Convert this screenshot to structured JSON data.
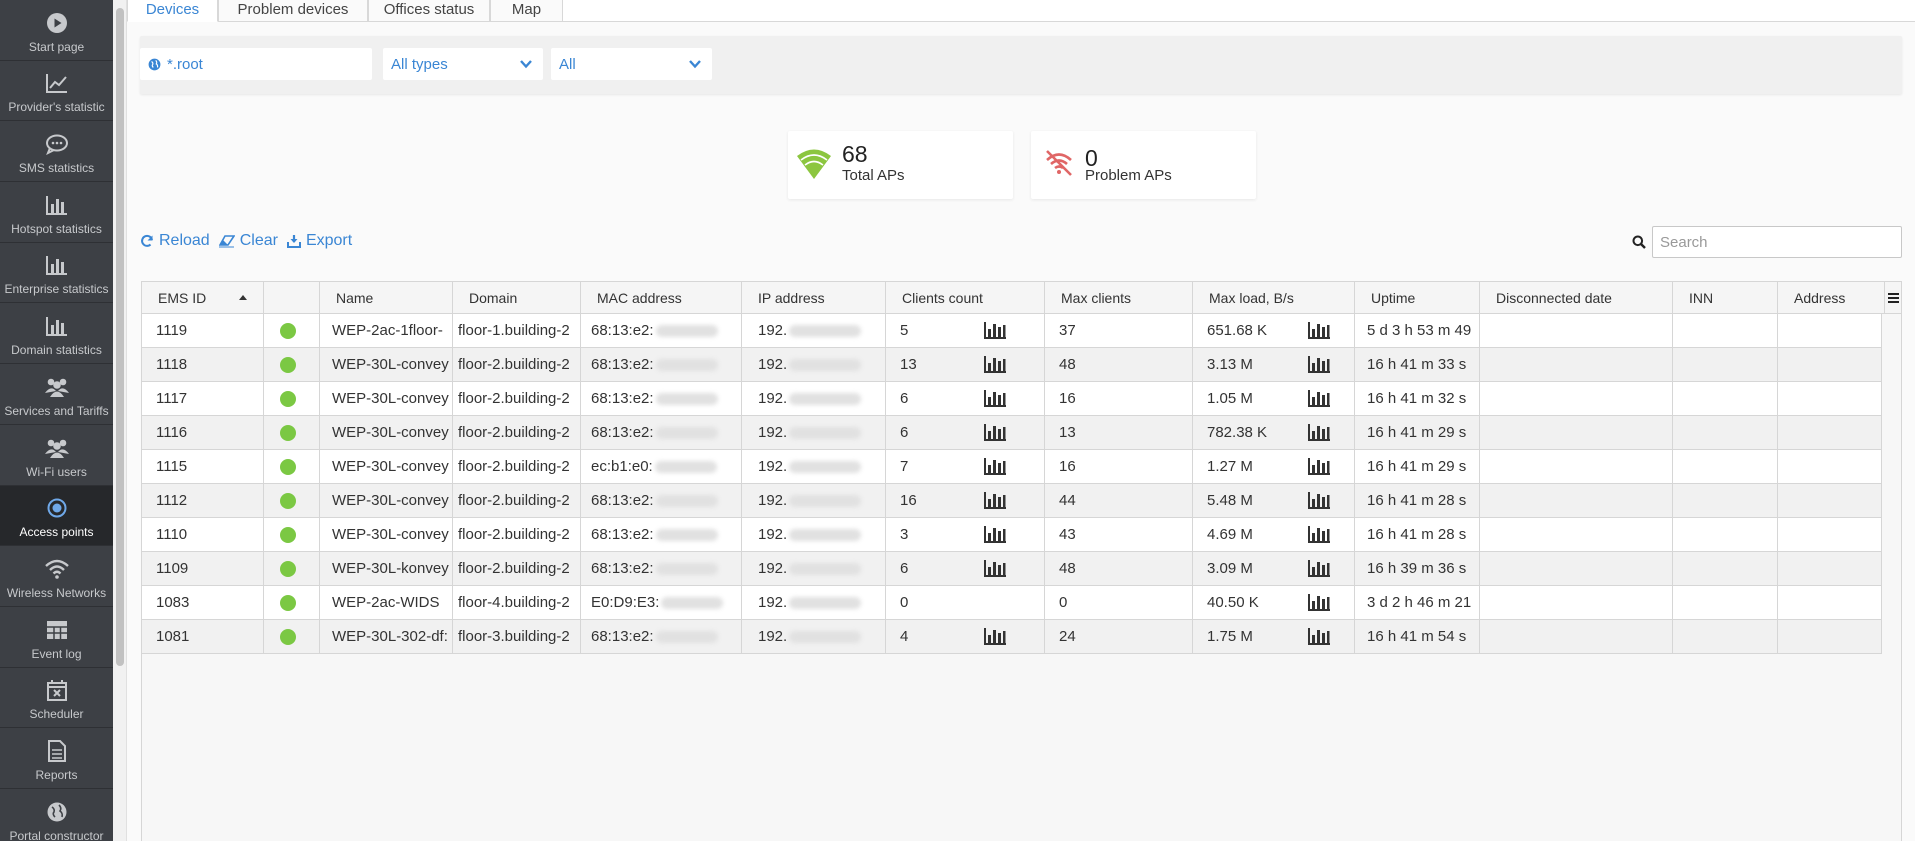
{
  "sidebar": {
    "items": [
      {
        "label": "Start page",
        "icon": "play-circle-icon"
      },
      {
        "label": "Provider's statistic",
        "icon": "line-chart-icon"
      },
      {
        "label": "SMS statistics",
        "icon": "chat-bubble-icon"
      },
      {
        "label": "Hotspot statistics",
        "icon": "bar-chart-icon"
      },
      {
        "label": "Enterprise statistics",
        "icon": "bar-chart-icon"
      },
      {
        "label": "Domain statistics",
        "icon": "bar-chart-icon"
      },
      {
        "label": "Services and Tariffs",
        "icon": "users-icon"
      },
      {
        "label": "Wi-Fi users",
        "icon": "users-icon"
      },
      {
        "label": "Access points",
        "icon": "target-icon",
        "active": true
      },
      {
        "label": "Wireless Networks",
        "icon": "wifi-icon"
      },
      {
        "label": "Event log",
        "icon": "table-icon"
      },
      {
        "label": "Scheduler",
        "icon": "calendar-x-icon"
      },
      {
        "label": "Reports",
        "icon": "document-icon"
      },
      {
        "label": "Portal constructor",
        "icon": "globe-icon"
      }
    ]
  },
  "tabs": [
    {
      "label": "Devices",
      "active": true
    },
    {
      "label": "Problem devices"
    },
    {
      "label": "Offices status"
    },
    {
      "label": "Map"
    }
  ],
  "filters": {
    "domain": "*.root",
    "type": "All types",
    "status": "All"
  },
  "stats": {
    "total": {
      "value": "68",
      "label": "Total APs"
    },
    "problem": {
      "value": "0",
      "label": "Problem APs"
    }
  },
  "actions": {
    "reload": "Reload",
    "clear": "Clear",
    "export": "Export"
  },
  "search": {
    "placeholder": "Search"
  },
  "table": {
    "columns": [
      "EMS ID",
      "",
      "Name",
      "Domain",
      "MAC address",
      "IP address",
      "Clients count",
      "Max clients",
      "Max load, B/s",
      "Uptime",
      "Disconnected date",
      "INN",
      "Address"
    ],
    "rows": [
      {
        "id": "1119",
        "name": "WEP-2ac-1floor-",
        "domain": "floor-1.building-2",
        "mac": "68:13:e2:",
        "ip": "192.",
        "clients": "5",
        "clients_chart": true,
        "max_clients": "37",
        "max_load": "651.68 K",
        "uptime": "5 d 3 h 53 m 49"
      },
      {
        "id": "1118",
        "name": "WEP-30L-convey",
        "domain": "floor-2.building-2",
        "mac": "68:13:e2:",
        "ip": "192.",
        "clients": "13",
        "clients_chart": true,
        "max_clients": "48",
        "max_load": "3.13 M",
        "uptime": "16 h 41 m 33 s"
      },
      {
        "id": "1117",
        "name": "WEP-30L-convey",
        "domain": "floor-2.building-2",
        "mac": "68:13:e2:",
        "ip": "192.",
        "clients": "6",
        "clients_chart": true,
        "max_clients": "16",
        "max_load": "1.05 M",
        "uptime": "16 h 41 m 32 s"
      },
      {
        "id": "1116",
        "name": "WEP-30L-convey",
        "domain": "floor-2.building-2",
        "mac": "68:13:e2:",
        "ip": "192.",
        "clients": "6",
        "clients_chart": true,
        "max_clients": "13",
        "max_load": "782.38 K",
        "uptime": "16 h 41 m 29 s"
      },
      {
        "id": "1115",
        "name": "WEP-30L-convey",
        "domain": "floor-2.building-2",
        "mac": "ec:b1:e0:",
        "ip": "192.",
        "clients": "7",
        "clients_chart": true,
        "max_clients": "16",
        "max_load": "1.27 M",
        "uptime": "16 h 41 m 29 s"
      },
      {
        "id": "1112",
        "name": "WEP-30L-convey",
        "domain": "floor-2.building-2",
        "mac": "68:13:e2:",
        "ip": "192.",
        "clients": "16",
        "clients_chart": true,
        "max_clients": "44",
        "max_load": "5.48 M",
        "uptime": "16 h 41 m 28 s"
      },
      {
        "id": "1110",
        "name": "WEP-30L-convey",
        "domain": "floor-2.building-2",
        "mac": "68:13:e2:",
        "ip": "192.",
        "clients": "3",
        "clients_chart": true,
        "max_clients": "43",
        "max_load": "4.69 M",
        "uptime": "16 h 41 m 28 s"
      },
      {
        "id": "1109",
        "name": "WEP-30L-konvey",
        "domain": "floor-2.building-2",
        "mac": "68:13:e2:",
        "ip": "192.",
        "clients": "6",
        "clients_chart": true,
        "max_clients": "48",
        "max_load": "3.09 M",
        "uptime": "16 h 39 m 36 s"
      },
      {
        "id": "1083",
        "name": "WEP-2ac-WIDS",
        "domain": "floor-4.building-2",
        "mac": "E0:D9:E3:",
        "ip": "192.",
        "clients": "0",
        "clients_chart": false,
        "max_clients": "0",
        "max_load": "40.50 K",
        "uptime": "3 d 2 h 46 m 21"
      },
      {
        "id": "1081",
        "name": "WEP-30L-302-df:",
        "domain": "floor-3.building-2",
        "mac": "68:13:e2:",
        "ip": "192.",
        "clients": "4",
        "clients_chart": true,
        "max_clients": "24",
        "max_load": "1.75 M",
        "uptime": "16 h 41 m 54 s"
      }
    ]
  },
  "colors": {
    "accent": "#3a86d4",
    "online": "#7bc843",
    "wifi_ok": "#8cc63f",
    "wifi_problem": "#e06666",
    "sidebar_bg": "#3d4045"
  }
}
